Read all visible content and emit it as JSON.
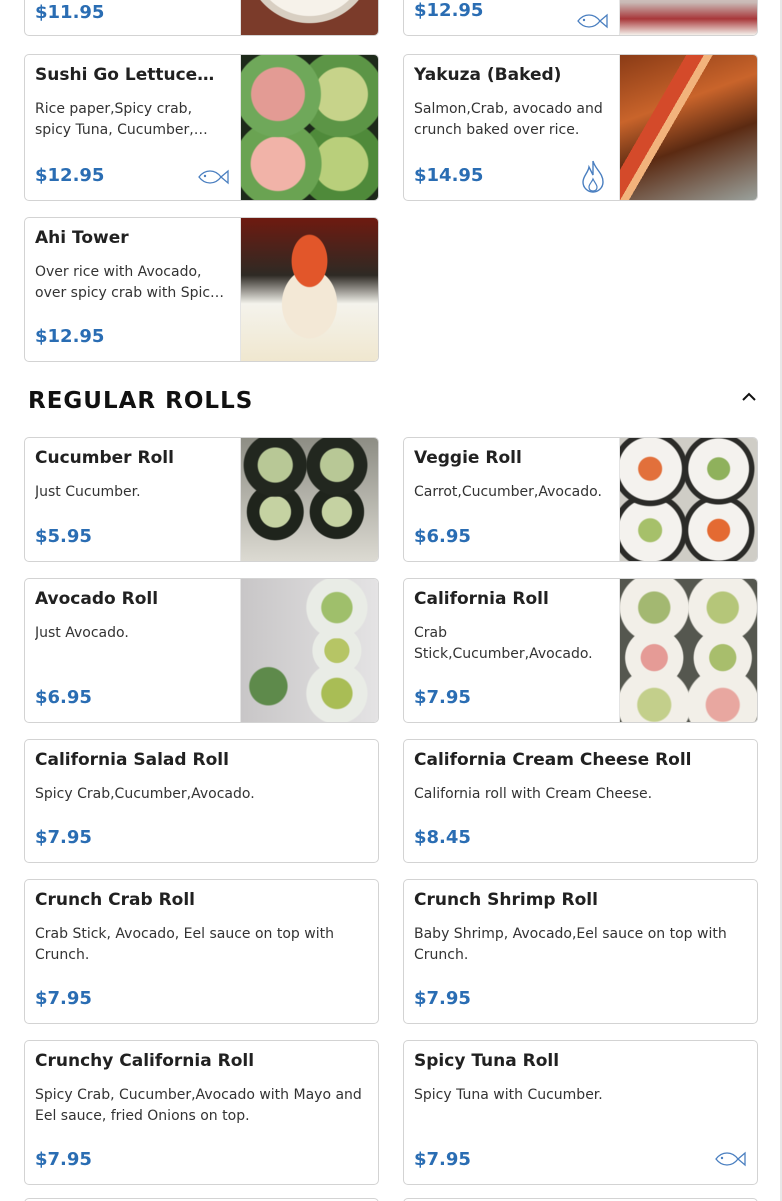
{
  "top_cards": [
    {
      "price": "$11.95",
      "icon": "none"
    },
    {
      "price": "$12.95",
      "icon": "fish-icon"
    }
  ],
  "special_rolls": [
    {
      "name": "Sushi Go Lettuce…",
      "description": "Rice paper,Spicy crab, spicy Tuna, Cucumber,…",
      "price": "$12.95",
      "icon": "fish-icon"
    },
    {
      "name": "Yakuza (Baked)",
      "description": "Salmon,Crab, avocado and crunch baked over rice.",
      "price": "$14.95",
      "icon": "flame-icon"
    },
    {
      "name": "Ahi Tower",
      "description": "Over rice with Avocado, over spicy crab with Spic…",
      "price": "$12.95",
      "icon": "none"
    }
  ],
  "section": {
    "title": "REGULAR ROLLS",
    "collapse_icon": "chevron-up-icon"
  },
  "regular_rolls": [
    {
      "name": "Cucumber Roll",
      "description": "Just Cucumber.",
      "price": "$5.95"
    },
    {
      "name": "Veggie Roll",
      "description": "Carrot,Cucumber,Avocado.",
      "price": "$6.95"
    },
    {
      "name": "Avocado Roll",
      "description": "Just Avocado.",
      "price": "$6.95"
    },
    {
      "name": "California Roll",
      "description": "Crab Stick,Cucumber,Avocado.",
      "price": "$7.95"
    },
    {
      "name": "California Salad Roll",
      "description": "Spicy Crab,Cucumber,Avocado.",
      "price": "$7.95"
    },
    {
      "name": "California Cream Cheese Roll",
      "description": "California roll with Cream Cheese.",
      "price": "$8.45"
    },
    {
      "name": "Crunch Crab Roll",
      "description": "Crab Stick, Avocado, Eel sauce on top with Crunch.",
      "price": "$7.95"
    },
    {
      "name": "Crunch Shrimp Roll",
      "description": "Baby Shrimp, Avocado,Eel sauce on top with Crunch.",
      "price": "$7.95"
    },
    {
      "name": "Crunchy California Roll",
      "description": "Spicy Crab, Cucumber,Avocado with Mayo and Eel sauce, fried Onions on top.",
      "price": "$7.95"
    },
    {
      "name": "Spicy Tuna Roll",
      "description": "Spicy Tuna with Cucumber.",
      "price": "$7.95",
      "icon": "fish-icon"
    }
  ],
  "colors": {
    "price": "#2a6db3",
    "border": "#d3d3d3",
    "icon": "#4a7fc0"
  }
}
